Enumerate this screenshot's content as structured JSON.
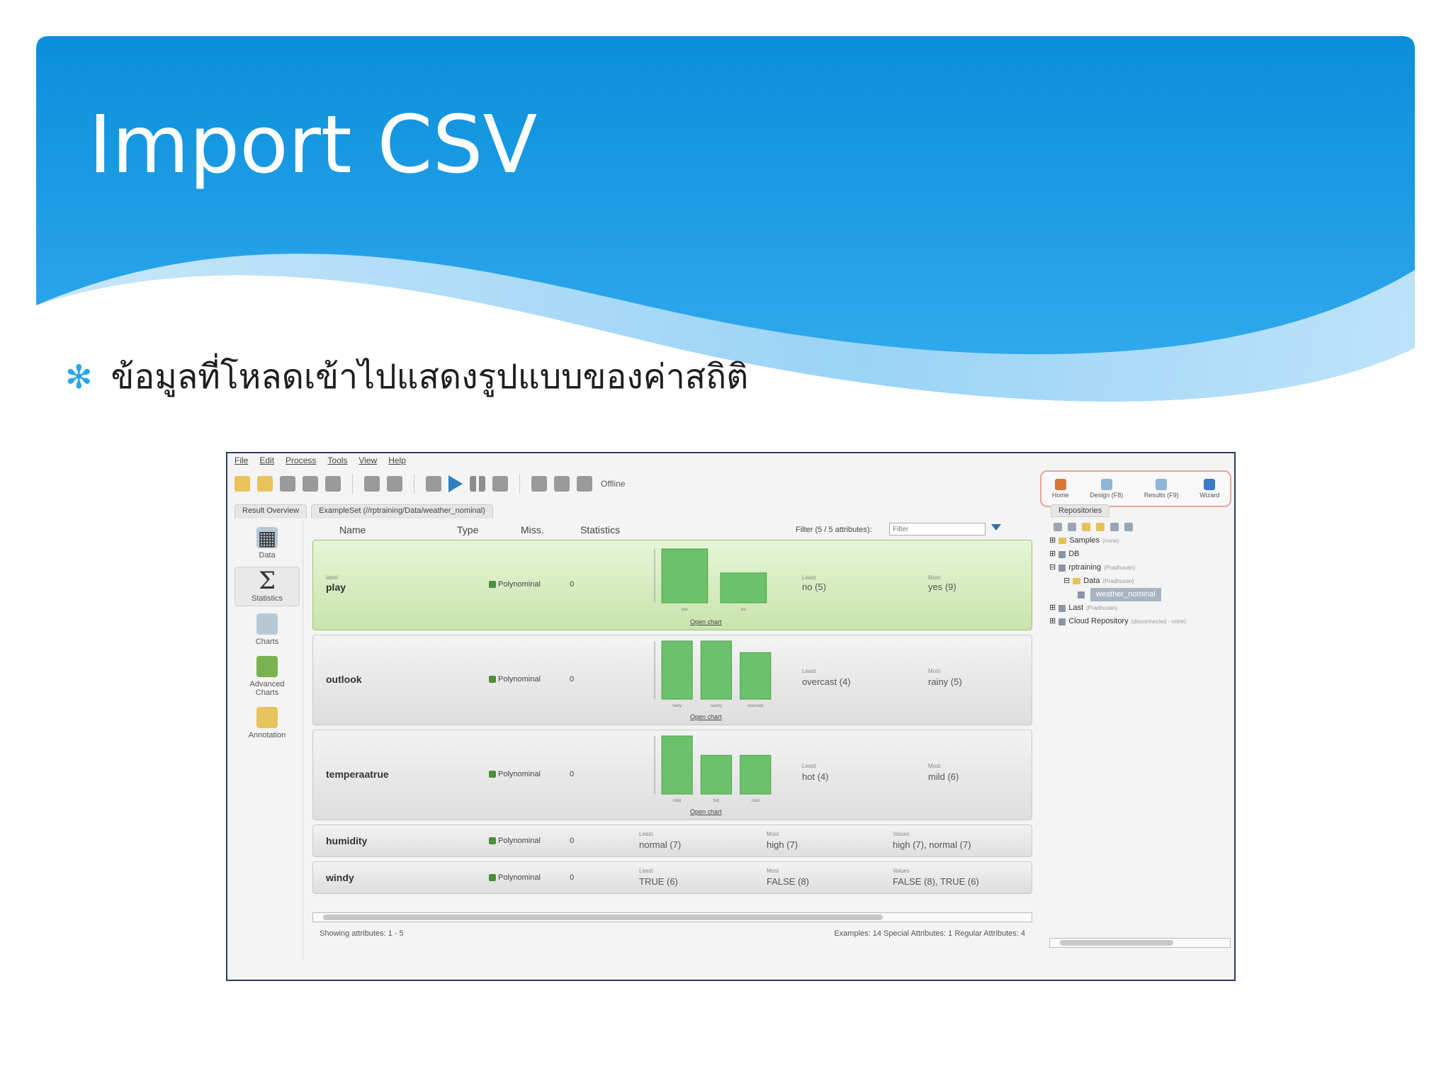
{
  "slide": {
    "title": "Import CSV",
    "bullet_text": "ข้อมูลที่โหลดเข้าไปแสดงรูปแบบของค่าสถิติ",
    "header_color": "#1a9be3"
  },
  "app": {
    "menu": [
      "File",
      "Edit",
      "Process",
      "Tools",
      "View",
      "Help"
    ],
    "toolbar": {
      "offline_label": "Offline"
    },
    "perspectives": [
      "Home",
      "Design (F8)",
      "Results (F9)",
      "Wizard"
    ],
    "tabs": {
      "result_overview": "Result Overview",
      "example_set": "ExampleSet (//rptraining/Data/weather_nominal)",
      "repositories": "Repositories"
    },
    "sidebar": [
      "Data",
      "Statistics",
      "Charts",
      "Advanced Charts",
      "Annotation"
    ],
    "columns": {
      "name": "Name",
      "type": "Type",
      "miss": "Miss.",
      "statistics": "Statistics",
      "filter": "Filter (5 / 5 attributes):",
      "filter_placeholder": "Filter"
    },
    "attributes": [
      {
        "role": "label",
        "name": "play",
        "type": "Polynominal",
        "missing": "0",
        "least_head": "Least",
        "least": "no (5)",
        "most_head": "Most",
        "most": "yes (9)",
        "bars": [
          9,
          5
        ],
        "bar_labels": [
          "yes",
          "no"
        ],
        "open_chart": "Open chart"
      },
      {
        "name": "outlook",
        "type": "Polynominal",
        "missing": "0",
        "least_head": "Least",
        "least": "overcast (4)",
        "most_head": "Most",
        "most": "rainy (5)",
        "bars": [
          5,
          5,
          4
        ],
        "bar_labels": [
          "rainy",
          "sunny",
          "overcast"
        ],
        "open_chart": "Open chart"
      },
      {
        "name": "temperaatrue",
        "type": "Polynominal",
        "missing": "0",
        "least_head": "Least",
        "least": "hot (4)",
        "most_head": "Most",
        "most": "mild (6)",
        "bars": [
          6,
          4,
          4
        ],
        "bar_labels": [
          "mild",
          "hot",
          "cool"
        ],
        "open_chart": "Open chart"
      },
      {
        "name": "humidity",
        "type": "Polynominal",
        "missing": "0",
        "least_head": "Least",
        "least": "normal (7)",
        "most_head": "Most",
        "most": "high (7)",
        "values_head": "Values",
        "values": "high (7), normal (7)"
      },
      {
        "name": "windy",
        "type": "Polynominal",
        "missing": "0",
        "least_head": "Least",
        "least": "TRUE (6)",
        "most_head": "Most",
        "most": "FALSE (8)",
        "values_head": "Values",
        "values": "FALSE (8), TRUE (6)"
      }
    ],
    "status": {
      "left": "Showing attributes: 1 - 5",
      "right": "Examples: 14   Special Attributes: 1   Regular Attributes: 4"
    },
    "repo_tree": [
      {
        "label": "Samples",
        "note": "(none)"
      },
      {
        "label": "DB",
        "note": ""
      },
      {
        "label": "rptraining",
        "note": "(Pradhuvan)"
      },
      {
        "label": "Data",
        "note": "(Pradhuvan)"
      },
      {
        "label": "weather_nominal",
        "note": ""
      },
      {
        "label": "Last",
        "note": "(Pradhuvan)"
      },
      {
        "label": "Cloud Repository",
        "note": "(disconnected - none)"
      }
    ]
  }
}
